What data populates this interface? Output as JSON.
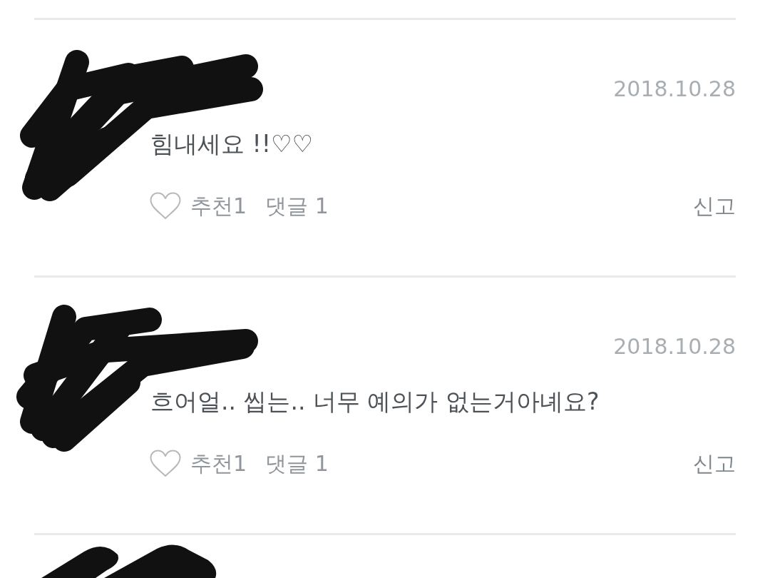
{
  "comments": [
    {
      "redacted": true,
      "date": "2018.10.28",
      "text": "힘내세요 !!♡♡",
      "liked": false,
      "recommend": "추천1",
      "replies": "댓글 1",
      "report": "신고"
    },
    {
      "redacted": true,
      "date": "2018.10.28",
      "text": "흐어얼.. 씹는.. 너무 예의가 없는거아녜요?",
      "liked": false,
      "recommend": "추천1",
      "replies": "댓글 1",
      "report": "신고"
    },
    {
      "redacted": true
    }
  ]
}
